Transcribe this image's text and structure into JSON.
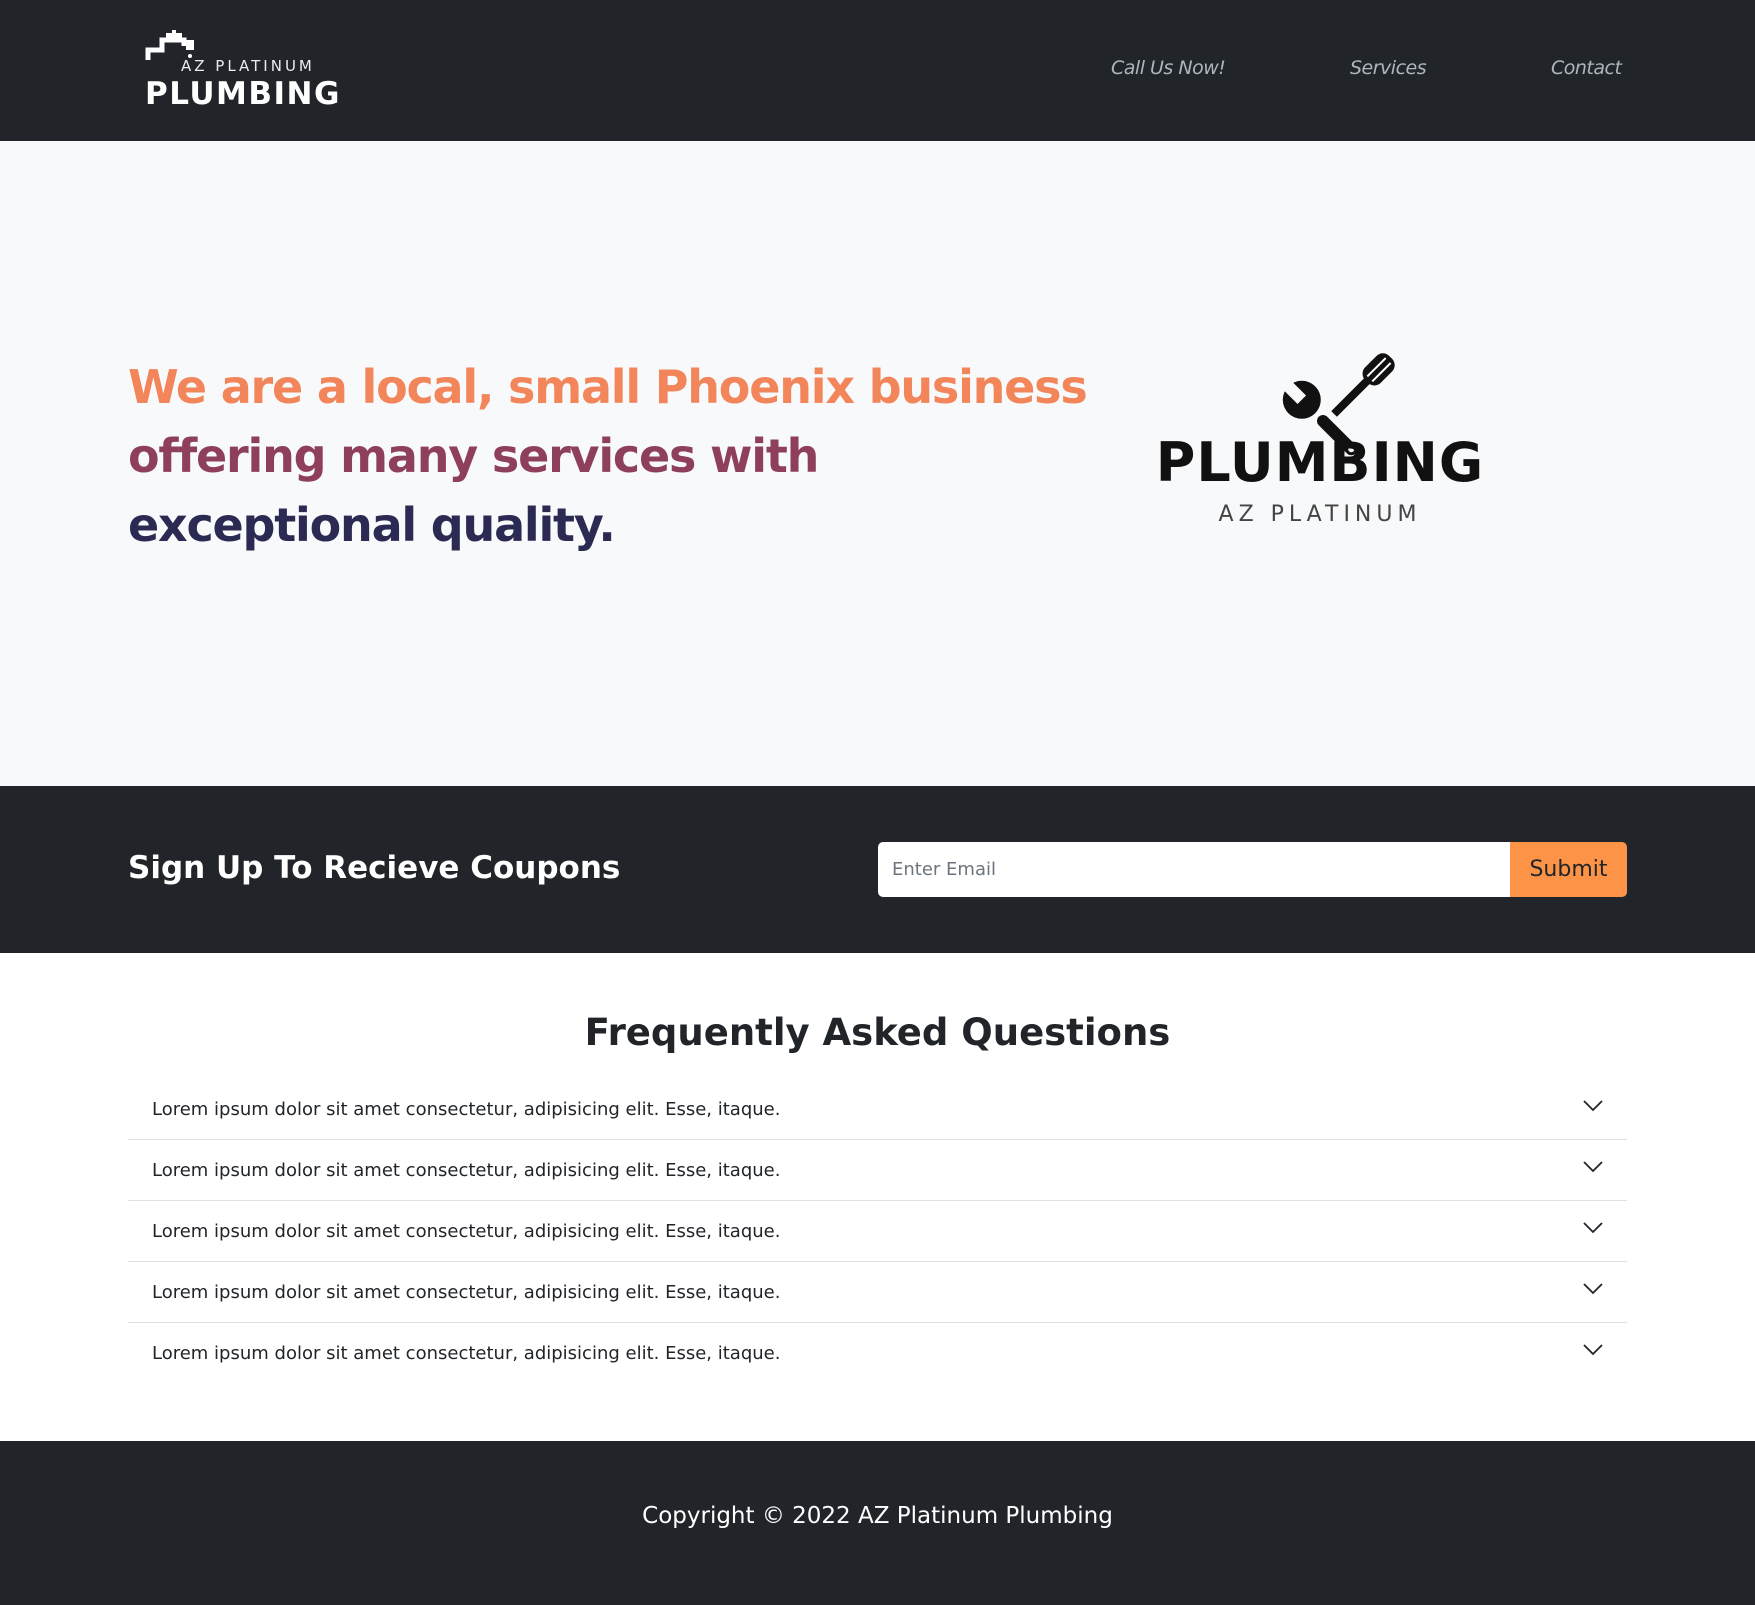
{
  "navbar": {
    "brand_small": "AZ PLATINUM",
    "brand_big": "PLUMBING",
    "links": [
      {
        "label": "Call Us Now!"
      },
      {
        "label": "Services"
      },
      {
        "label": "Contact"
      }
    ]
  },
  "hero": {
    "lines": [
      "We are a local, small Phoenix business",
      "offering many services with",
      "exceptional quality."
    ],
    "colors": [
      "#f2865a",
      "#8e3f5c",
      "#2a2a52"
    ],
    "logo": {
      "title": "PLUMBING",
      "subtitle": "AZ PLATINUM",
      "icon": "wrench-screwdriver-icon"
    }
  },
  "signup": {
    "title": "Sign Up To Recieve Coupons",
    "email_placeholder": "Enter Email",
    "email_value": "",
    "submit_label": "Submit",
    "accent": "#fd9346"
  },
  "faq": {
    "title": "Frequently Asked Questions",
    "items": [
      {
        "question": "Lorem ipsum dolor sit amet consectetur, adipisicing elit. Esse, itaque."
      },
      {
        "question": "Lorem ipsum dolor sit amet consectetur, adipisicing elit. Esse, itaque."
      },
      {
        "question": "Lorem ipsum dolor sit amet consectetur, adipisicing elit. Esse, itaque."
      },
      {
        "question": "Lorem ipsum dolor sit amet consectetur, adipisicing elit. Esse, itaque."
      },
      {
        "question": "Lorem ipsum dolor sit amet consectetur, adipisicing elit. Esse, itaque."
      }
    ],
    "icon": "chevron-down-icon"
  },
  "footer": {
    "copyright": "Copyright © 2022 AZ Platinum Plumbing"
  },
  "colors": {
    "dark": "#212529",
    "hero_bg": "#f8f9fa",
    "nav_link": "#adb5bd"
  }
}
